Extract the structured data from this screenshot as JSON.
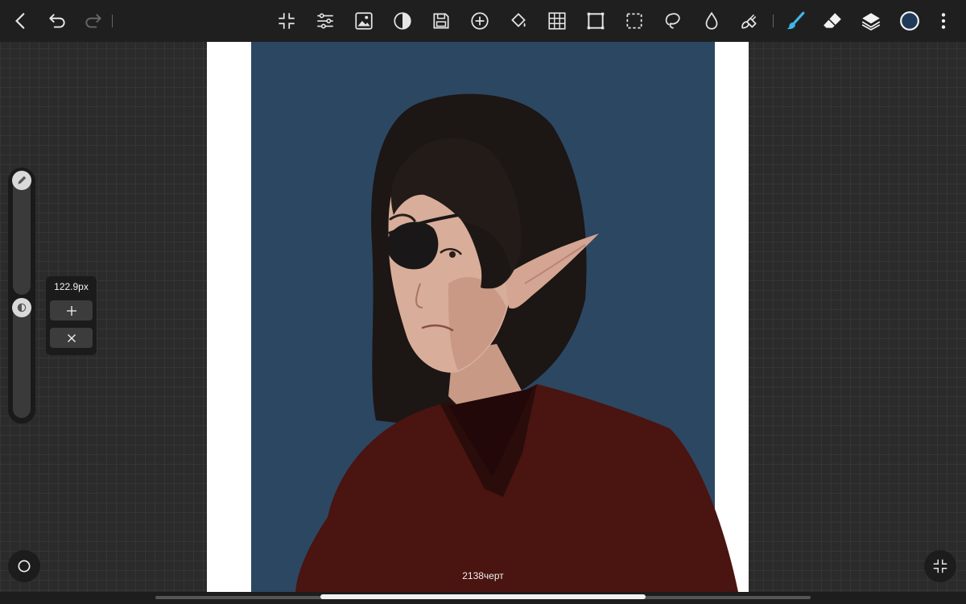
{
  "toolbar": {
    "left": [
      {
        "name": "back-button",
        "icon": "chevron-left-icon"
      },
      {
        "name": "undo-button",
        "icon": "undo-icon"
      },
      {
        "name": "redo-button",
        "icon": "redo-icon"
      }
    ],
    "center": [
      {
        "name": "fit-screen-button",
        "icon": "collapse-icon"
      },
      {
        "name": "adjustments-button",
        "icon": "sliders-icon"
      },
      {
        "name": "import-image-button",
        "icon": "image-icon"
      },
      {
        "name": "contrast-button",
        "icon": "contrast-icon"
      },
      {
        "name": "save-button",
        "icon": "save-icon"
      },
      {
        "name": "add-button",
        "icon": "plus-circle-icon"
      },
      {
        "name": "fill-button",
        "icon": "paint-bucket-icon"
      },
      {
        "name": "grid-button",
        "icon": "grid-icon"
      },
      {
        "name": "transform-button",
        "icon": "transform-icon"
      },
      {
        "name": "selection-button",
        "icon": "dashed-select-icon"
      },
      {
        "name": "lasso-button",
        "icon": "lasso-icon"
      },
      {
        "name": "blend-button",
        "icon": "droplet-icon"
      },
      {
        "name": "smudge-button",
        "icon": "smudge-icon"
      }
    ],
    "right": [
      {
        "name": "brush-button",
        "icon": "brush-icon",
        "color": "#3fb5e6"
      },
      {
        "name": "eraser-button",
        "icon": "eraser-icon"
      },
      {
        "name": "layers-button",
        "icon": "layers-icon"
      },
      {
        "name": "color-button",
        "icon": "color-circle-icon",
        "color": "#1f3a58"
      },
      {
        "name": "more-button",
        "icon": "more-vertical-icon"
      }
    ]
  },
  "brush_panel": {
    "size_label": "122.9px",
    "plus_icon": "plus-icon",
    "clear_icon": "close-icon",
    "size_knob_icon": "pencil-icon",
    "opacity_knob_icon": "opacity-icon"
  },
  "canvas": {
    "background_color": "#2c4762",
    "watermark": "2138черт"
  },
  "bottom": {
    "left_icon": "circle-icon",
    "right_icon": "compress-icon"
  },
  "colors": {
    "accent": "#3fb5e6",
    "current_color": "#1f3a58",
    "robe": "#4a1410",
    "hair": "#1c1614",
    "skin": "#d8ad99"
  }
}
